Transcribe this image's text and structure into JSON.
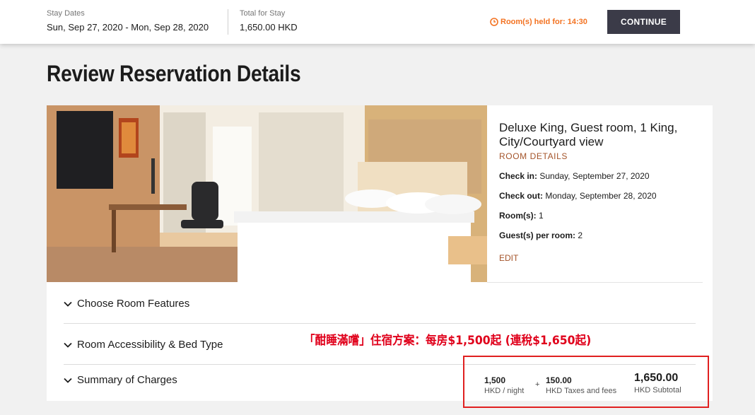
{
  "header": {
    "stay_dates_label": "Stay Dates",
    "stay_dates_value": "Sun, Sep 27, 2020 - Mon, Sep 28, 2020",
    "total_label": "Total for Stay",
    "total_value": "1,650.00 HKD",
    "hold_text": "Room(s) held for: 14:30",
    "continue_label": "CONTINUE"
  },
  "page": {
    "title": "Review Reservation Details"
  },
  "room": {
    "name": "Deluxe King, Guest room, 1 King, City/Courtyard view",
    "details_link": "ROOM DETAILS",
    "check_in_label": "Check in:",
    "check_in_value": "Sunday, September 27, 2020",
    "check_out_label": "Check out:",
    "check_out_value": "Monday, September 28, 2020",
    "rooms_label": "Room(s):",
    "rooms_value": "1",
    "guests_label": "Guest(s) per room:",
    "guests_value": "2",
    "edit_label": "EDIT"
  },
  "sections": {
    "room_features": "Choose Room Features",
    "accessibility": "Room Accessibility & Bed Type",
    "charges": "Summary of Charges"
  },
  "promo_text": "「酣睡滿嚐」住宿方案：每房$1,500起 (連稅$1,650起)",
  "charges": {
    "nightly_value": "1,500",
    "nightly_caption": "HKD / night",
    "plus": "+",
    "taxes_value": "150.00",
    "taxes_caption": "HKD Taxes and fees",
    "subtotal_value": "1,650.00",
    "subtotal_caption": "HKD Subtotal"
  },
  "colors": {
    "accent_link": "#a4542a",
    "hold_orange": "#f37221",
    "continue_bg": "#3b3b48",
    "promo_red": "#e0001b",
    "highlight_border": "#e02020"
  }
}
